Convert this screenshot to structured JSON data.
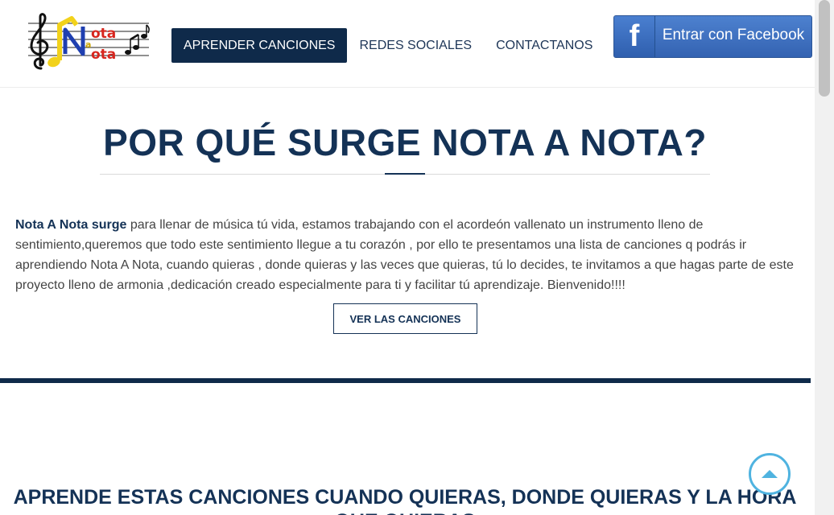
{
  "header": {
    "logo_alt": "Nota a Nota",
    "nav": [
      {
        "label": "APRENDER CANCIONES",
        "active": true
      },
      {
        "label": "REDES SOCIALES",
        "active": false
      },
      {
        "label": "CONTACTANOS",
        "active": false
      }
    ],
    "facebook_button": {
      "icon_letter": "f",
      "label": "Entrar con Facebook"
    }
  },
  "main": {
    "title": "POR QUÉ SURGE NOTA A NOTA?",
    "intro_bold": "Nota A Nota surge",
    "intro_text": " para llenar de música tú vida, estamos trabajando con el acordeón vallenato un instrumento lleno de sentimiento,queremos que todo este sentimiento llegue a tu corazón , por ello te presentamos una lista de canciones q podrás ir aprendiendo Nota A Nota, cuando quieras , donde quieras y las veces que quieras, tú lo decides, te invitamos a que hagas parte de este proyecto lleno de armonia ,dedicación creado especialmente para ti y facilitar tú aprendizaje. Bienvenido!!!!",
    "cta_label": "VER LAS CANCIONES"
  },
  "section2": {
    "title": "APRENDE ESTAS CANCIONES CUANDO QUIERAS, DONDE QUIERAS Y LA HORA QUE QUIERAS"
  },
  "colors": {
    "primary": "#143256",
    "facebook": "#3b6fbf",
    "back_to_top": "#4fb3e0"
  },
  "icons": {
    "back_to_top": "chevron-up-icon",
    "facebook": "facebook-icon"
  }
}
